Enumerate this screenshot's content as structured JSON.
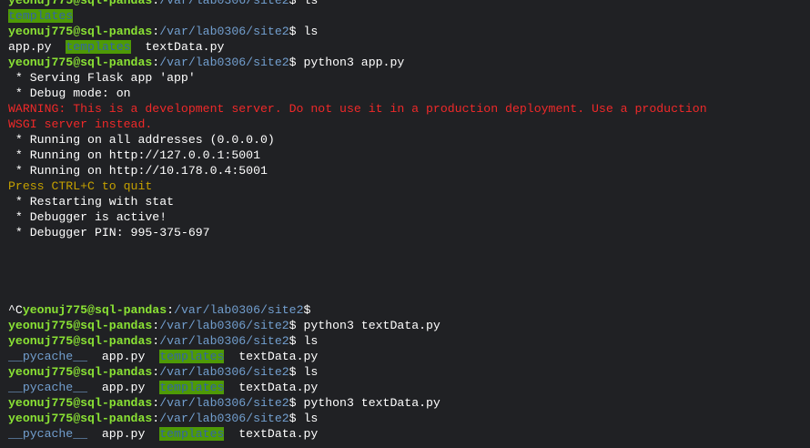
{
  "prompt": {
    "user_host": "yeonuj775@sql-pandas",
    "separator": ":",
    "path": "/var/lab0306/site2",
    "dollar": "$ "
  },
  "lines": [
    {
      "type": "cmd",
      "cmd": "ls"
    },
    {
      "type": "ls",
      "items": [
        {
          "text": "templates",
          "kind": "dir"
        }
      ]
    },
    {
      "type": "cmd",
      "cmd": "ls"
    },
    {
      "type": "ls",
      "items": [
        {
          "text": "app.py",
          "kind": "file"
        },
        {
          "text": "templates",
          "kind": "dir"
        },
        {
          "text": "textData.py",
          "kind": "file"
        }
      ]
    },
    {
      "type": "cmd",
      "cmd": "python3 app.py"
    },
    {
      "type": "out",
      "text": " * Serving Flask app 'app'"
    },
    {
      "type": "out",
      "text": " * Debug mode: on"
    },
    {
      "type": "warn",
      "text": "WARNING: This is a development server. Do not use it in a production deployment. Use a production"
    },
    {
      "type": "warn",
      "text": "WSGI server instead."
    },
    {
      "type": "out",
      "text": " * Running on all addresses (0.0.0.0)"
    },
    {
      "type": "out",
      "text": " * Running on http://127.0.0.1:5001"
    },
    {
      "type": "out",
      "text": " * Running on http://10.178.0.4:5001"
    },
    {
      "type": "info",
      "text": "Press CTRL+C to quit"
    },
    {
      "type": "out",
      "text": " * Restarting with stat"
    },
    {
      "type": "out",
      "text": " * Debugger is active!"
    },
    {
      "type": "out",
      "text": " * Debugger PIN: 995-375-697"
    },
    {
      "type": "blank"
    },
    {
      "type": "blank"
    },
    {
      "type": "blank"
    },
    {
      "type": "blank"
    },
    {
      "type": "cmd",
      "prefix": "^C",
      "cmd": ""
    },
    {
      "type": "cmd",
      "cmd": "python3 textData.py"
    },
    {
      "type": "cmd",
      "cmd": "ls"
    },
    {
      "type": "ls",
      "items": [
        {
          "text": "__pycache__",
          "kind": "pycache"
        },
        {
          "text": "app.py",
          "kind": "file"
        },
        {
          "text": "templates",
          "kind": "dir"
        },
        {
          "text": "textData.py",
          "kind": "file"
        }
      ]
    },
    {
      "type": "cmd",
      "cmd": "ls"
    },
    {
      "type": "ls",
      "items": [
        {
          "text": "__pycache__",
          "kind": "pycache"
        },
        {
          "text": "app.py",
          "kind": "file"
        },
        {
          "text": "templates",
          "kind": "dir"
        },
        {
          "text": "textData.py",
          "kind": "file"
        }
      ]
    },
    {
      "type": "cmd",
      "cmd": "python3 textData.py"
    },
    {
      "type": "cmd",
      "cmd": "ls"
    },
    {
      "type": "ls",
      "items": [
        {
          "text": "__pycache__",
          "kind": "pycache"
        },
        {
          "text": "app.py",
          "kind": "file"
        },
        {
          "text": "templates",
          "kind": "dir"
        },
        {
          "text": "textData.py",
          "kind": "file"
        }
      ]
    }
  ],
  "colors": {
    "background": "#202124",
    "prompt_user": "#8ae234",
    "prompt_path": "#729fcf",
    "warning": "#ef2929",
    "info": "#c4a000",
    "dir_bg": "#4e9a06",
    "dir_fg": "#3465a4"
  }
}
